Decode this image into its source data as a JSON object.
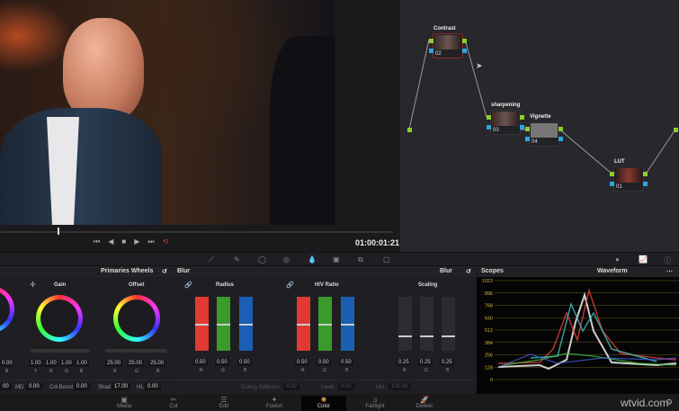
{
  "viewer": {
    "timecode": "01:00:01:21",
    "transport": [
      "⏮",
      "◀",
      "■",
      "▶",
      "⏭",
      "⟲"
    ]
  },
  "nodes": [
    {
      "label": "Contrast",
      "num": "02"
    },
    {
      "label": "sharpening",
      "num": "03"
    },
    {
      "label": "Vignette",
      "num": "04"
    },
    {
      "label": "LUT",
      "num": "01"
    }
  ],
  "primaries": {
    "title": "Primaries Wheels",
    "wheels": [
      {
        "label": "Gain",
        "values": [
          "1.00",
          "1.00",
          "1.00",
          "1.00"
        ],
        "channels": [
          "Y",
          "R",
          "G",
          "B"
        ]
      },
      {
        "label": "Offset",
        "values": [
          "25.00",
          "25.00",
          "25.00"
        ],
        "channels": [
          "R",
          "G",
          "B"
        ]
      }
    ],
    "left_value": "0.00",
    "left_channel": "B"
  },
  "blur": {
    "title": "Blur",
    "mode": "Blur",
    "groups": [
      {
        "label": "Radius",
        "values": [
          "0.50",
          "0.50",
          "0.50"
        ]
      },
      {
        "label": "H/V Ratio",
        "values": [
          "0.50",
          "0.50",
          "0.50"
        ]
      },
      {
        "label": "Scaling",
        "values": [
          "0.25",
          "0.25",
          "0.25"
        ]
      }
    ],
    "channels": [
      "R",
      "G",
      "B"
    ]
  },
  "bottom": {
    "left": "00",
    "md_label": "MD",
    "md": "0.00",
    "colboost_label": "Col Boost",
    "colboost": "0.00",
    "shad_label": "Shad",
    "shad": "17.00",
    "hl_label": "HL",
    "hl": "0.00",
    "coring_label": "Coring Softness",
    "coring": "0.00",
    "level_label": "Level",
    "level": "0.00",
    "mix_label": "Mix",
    "mix": "100.00"
  },
  "scopes": {
    "title": "Scopes",
    "mode": "Waveform",
    "ticks": [
      "1023",
      "896",
      "768",
      "640",
      "512",
      "384",
      "256",
      "128",
      "0"
    ]
  },
  "pages": [
    {
      "label": "Media",
      "icon": "▣"
    },
    {
      "label": "Cut",
      "icon": "✂"
    },
    {
      "label": "Edit",
      "icon": "☰"
    },
    {
      "label": "Fusion",
      "icon": "✦"
    },
    {
      "label": "Color",
      "icon": "✺",
      "active": true
    },
    {
      "label": "Fairlight",
      "icon": "♫"
    },
    {
      "label": "Deliver",
      "icon": "🚀"
    }
  ],
  "watermark": "wtvid.com",
  "colors": {
    "accent_red": "#e03a32",
    "accent_green": "#3a9a2a",
    "accent_blue": "#1a5fb4",
    "node_green": "#8ccf2a",
    "node_blue": "#2aa8e0"
  }
}
